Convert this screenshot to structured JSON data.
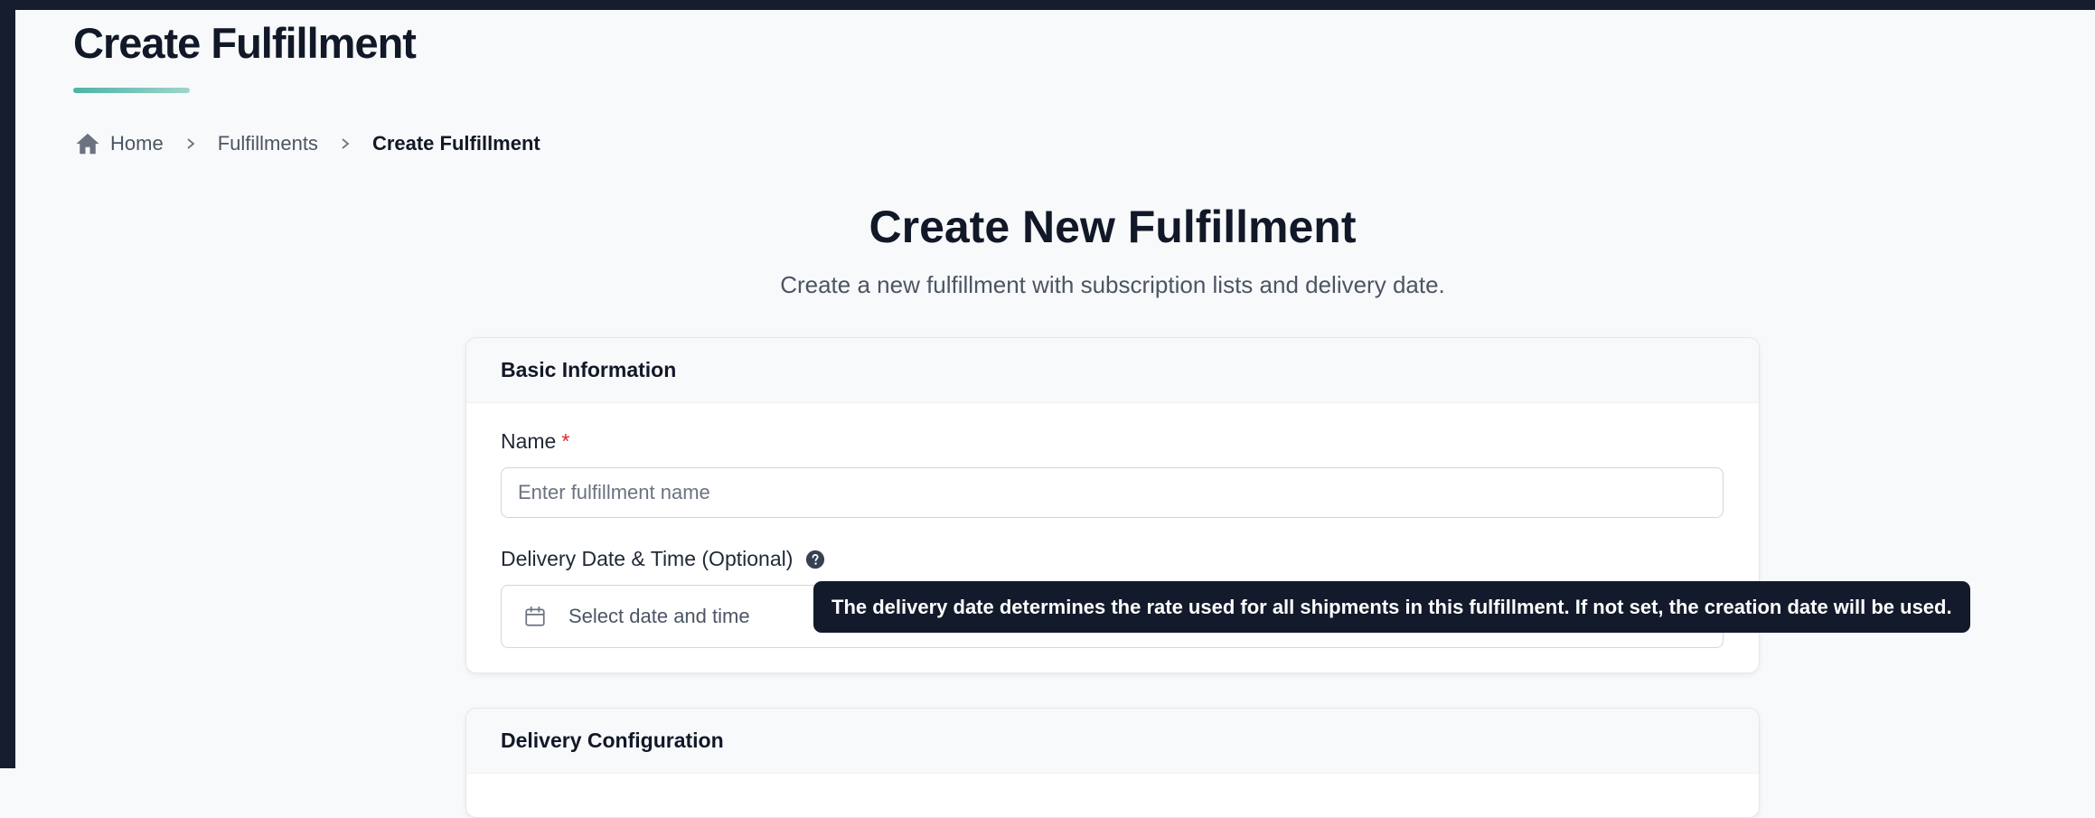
{
  "page": {
    "title": "Create Fulfillment"
  },
  "breadcrumb": {
    "home": "Home",
    "fulfillments": "Fulfillments",
    "current": "Create Fulfillment"
  },
  "main": {
    "heading": "Create New Fulfillment",
    "subheading": "Create a new fulfillment with subscription lists and delivery date."
  },
  "basic_info": {
    "header": "Basic Information",
    "name_label": "Name",
    "required_marker": "*",
    "name_placeholder": "Enter fulfillment name",
    "name_value": "",
    "delivery_label": "Delivery Date & Time (Optional)",
    "delivery_placeholder": "Select date and time"
  },
  "tooltip": {
    "text": "The delivery date determines the rate used for all shipments in this fulfillment. If not set, the creation date will be used."
  },
  "delivery_config": {
    "header": "Delivery Configuration"
  },
  "icons": {
    "home": "home-icon",
    "separator": "chevron-right-icon",
    "help": "question-circle-icon",
    "calendar": "calendar-icon"
  },
  "colors": {
    "accent": "#4db3a4",
    "required": "#dc2626",
    "dark_chrome": "#151d2e",
    "tooltip_bg": "#121a2b"
  }
}
